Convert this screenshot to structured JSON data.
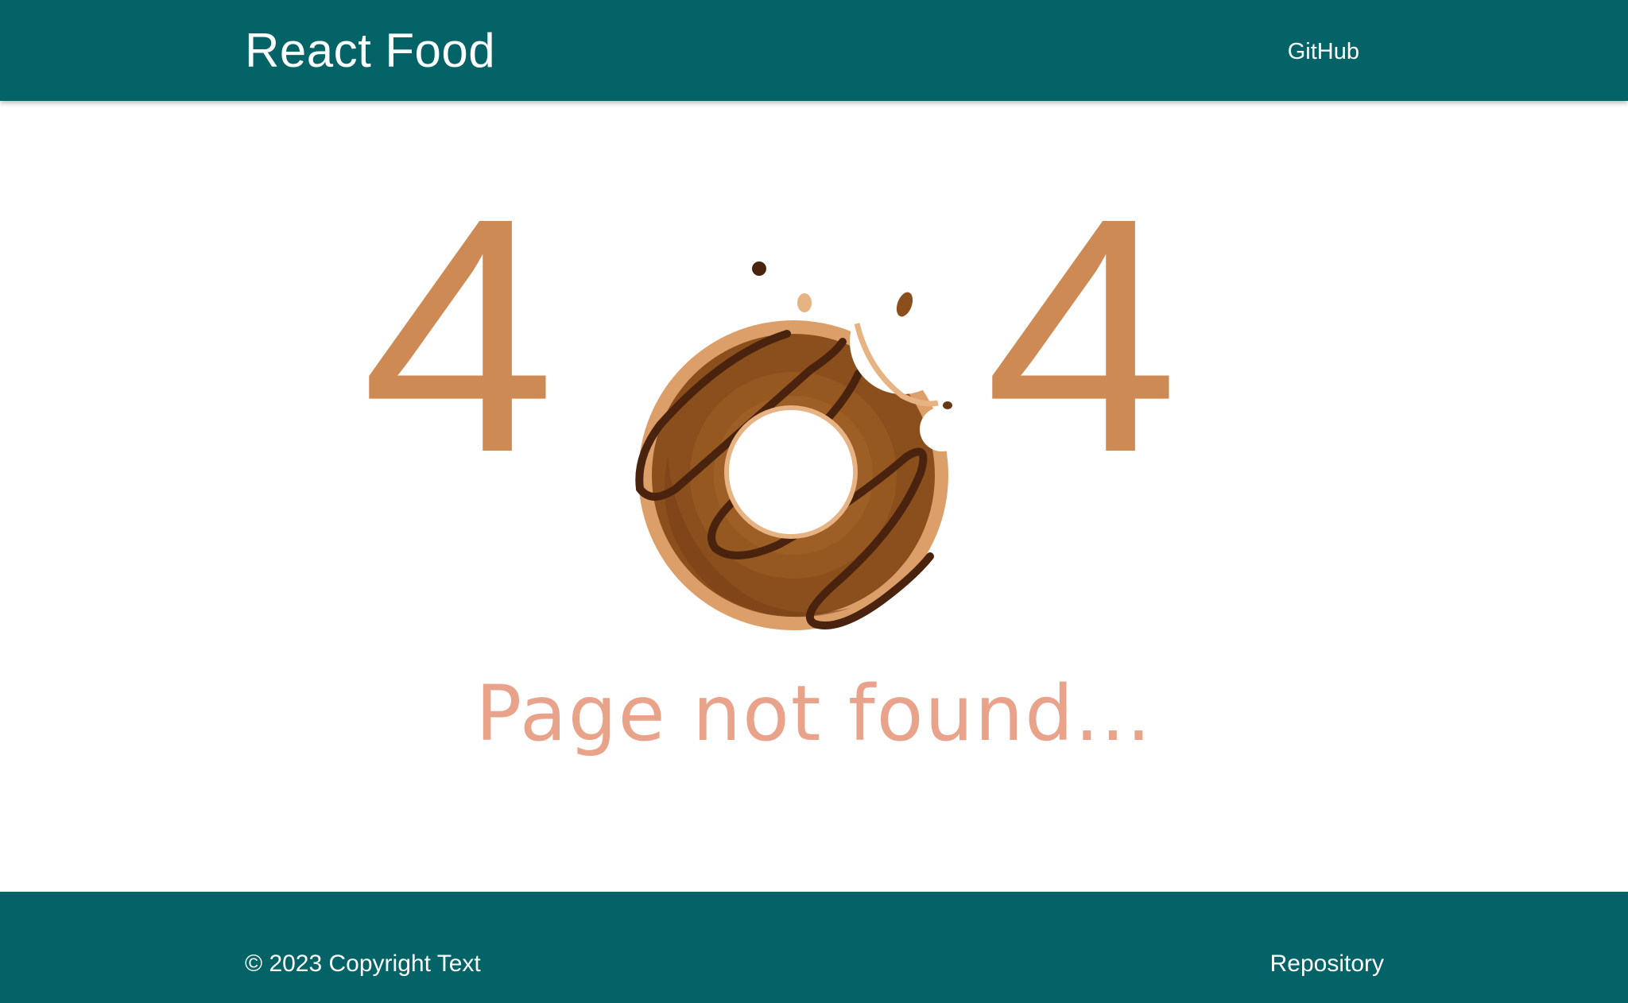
{
  "header": {
    "brand": "React Food",
    "nav_link": "GitHub"
  },
  "main": {
    "digit_left": "4",
    "digit_right": "4",
    "illustration_icon": "bitten-donut-icon",
    "message": "Page not found..."
  },
  "footer": {
    "copyright": "© 2023 Copyright Text",
    "link": "Repository"
  },
  "colors": {
    "header_bg": "#036367",
    "footer_bg": "#036367",
    "digit": "#cd8a54",
    "message": "#e9a38b",
    "donut_dough": "#dc9f6a",
    "donut_icing": "#8b4f1d",
    "donut_drizzle": "#4a230e"
  }
}
